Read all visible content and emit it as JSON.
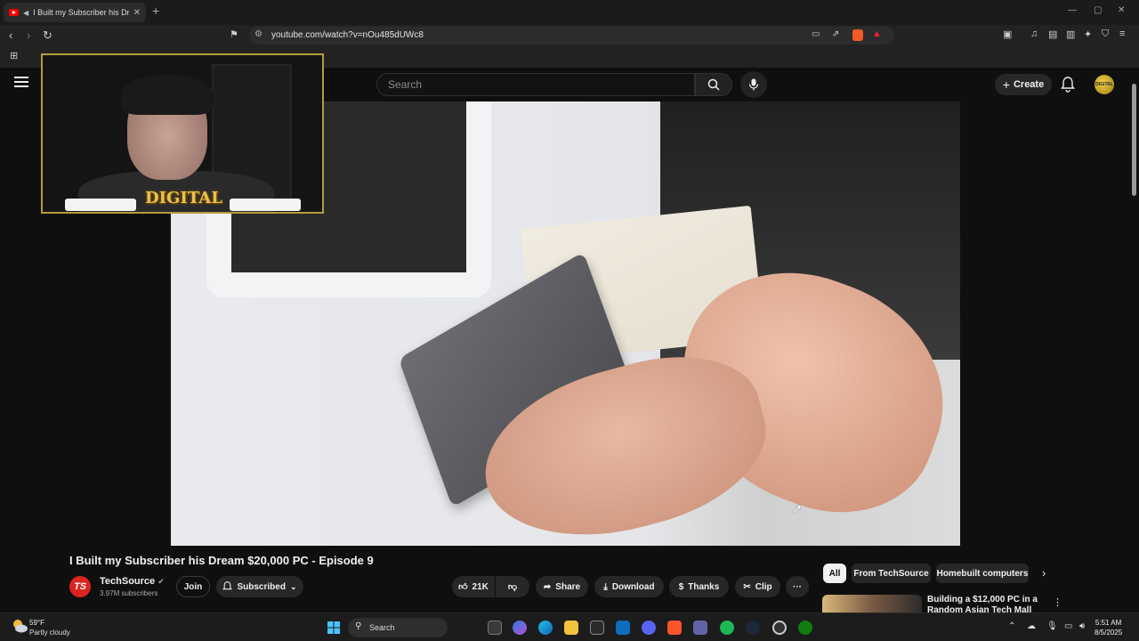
{
  "browser": {
    "tab_title": "I Built my Subscriber his Dream",
    "url": "youtube.com/watch?v=nOu485dUWc8"
  },
  "youtube": {
    "search_placeholder": "Search",
    "create_label": "Create",
    "avatar_text": "DIGITAL"
  },
  "webcam": {
    "overlay_logo": "DIGITAL"
  },
  "video": {
    "title": "I Built my Subscriber his Dream $20,000 PC - Episode 9",
    "channel_name": "TechSource",
    "channel_logo": "TS",
    "subscribers": "3.97M subscribers",
    "join_label": "Join",
    "subscribed_label": "Subscribed",
    "likes": "21K",
    "share_label": "Share",
    "download_label": "Download",
    "thanks_label": "Thanks",
    "clip_label": "Clip"
  },
  "recommendations": {
    "chips": [
      "All",
      "From TechSource",
      "Homebuilt computers"
    ],
    "items": [
      {
        "title": "Building a $12,000 PC in a Random Asian Tech Mall"
      }
    ]
  },
  "taskbar": {
    "temperature": "59°F",
    "condition": "Partly cloudy",
    "search_label": "Search",
    "time": "5:51 AM",
    "date": "8/5/2025"
  }
}
